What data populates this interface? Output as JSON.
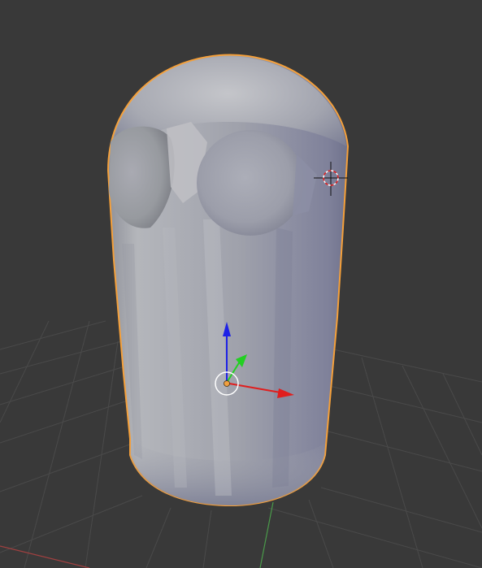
{
  "viewport": {
    "background_color": "#393939",
    "grid_color": "#4a4a4a",
    "x_axis_color": "#c24a4a",
    "y_axis_color": "#4ea24e"
  },
  "object": {
    "type": "mesh",
    "selected": true,
    "outline_color": "#f5a03a"
  },
  "gizmo": {
    "x_color": "#e01e1e",
    "y_color": "#22d022",
    "z_color": "#1e22e6",
    "origin_color": "#f0a040"
  },
  "cursor_3d": {
    "icon": "3d-cursor-icon"
  }
}
